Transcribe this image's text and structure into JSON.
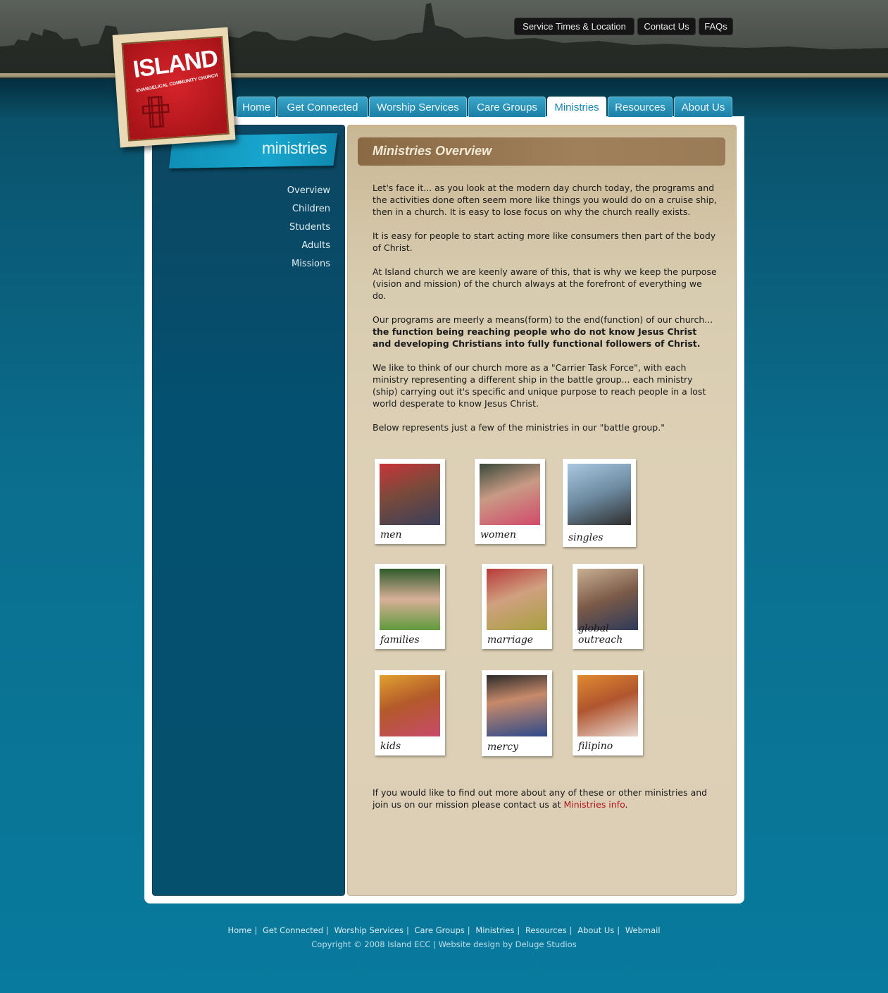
{
  "top_links": {
    "service_times": "Service Times & Location",
    "contact": "Contact Us",
    "faqs": "FAQs"
  },
  "logo": {
    "word": "ISLAND",
    "sub": "EVANGELICAL COMMUNITY CHURCH"
  },
  "nav": {
    "home": "Home",
    "get_connected": "Get Connected",
    "worship": "Worship Services",
    "care_groups": "Care Groups",
    "ministries": "Ministries",
    "resources": "Resources",
    "about": "About Us"
  },
  "sidebar": {
    "title": "ministries",
    "items": [
      "Overview",
      "Children",
      "Students",
      "Adults",
      "Missions"
    ]
  },
  "main": {
    "title": "Ministries Overview",
    "p1": "Let's face it... as you look at the modern day church today, the programs and the activities done often seem more like things you would do on a cruise ship, then in a church. It is easy to lose focus on why the church really exists.",
    "p2": "It is easy for people to start acting more like consumers then part of the body of Christ.",
    "p3": "At Island church we are keenly aware of this, that is why we keep the purpose (vision and mission) of the church always at the forefront of everything we do.",
    "p4_plain": "Our programs are meerly a means(form) to the end(function) of our church...",
    "p4_bold": "the function being reaching people who do not know Jesus Christ and developing Christians into fully functional followers of Christ.",
    "p5": "We like to think of our church more as a \"Carrier Task Force\", with each ministry representing a different ship in the battle group... each ministry (ship) carrying out it's specific and unique purpose to reach people in a lost world desperate to know Jesus Christ.",
    "p6": "Below represents just a few of the ministries in our \"battle group.\"",
    "closing_plain": "If you would like to find out more about any of these or other ministries and join us on our mission please contact us at ",
    "closing_link": "Ministries info",
    "closing_end": "."
  },
  "ministries": [
    {
      "caption": "men",
      "color": "#7a4a3a"
    },
    {
      "caption": "women",
      "color": "#8b6a5a"
    },
    {
      "caption": "singles",
      "color": "#6d8aa0"
    },
    {
      "caption": "families",
      "color": "#5f7d3c"
    },
    {
      "caption": "marriage",
      "color": "#a89a3f"
    },
    {
      "caption": "global outreach",
      "color": "#7a6a58"
    },
    {
      "caption": "kids",
      "color": "#b35a2a"
    },
    {
      "caption": "mercy",
      "color": "#5a6f8f"
    },
    {
      "caption": "filipino",
      "color": "#b0552e"
    }
  ],
  "footer": {
    "links": [
      "Home",
      "Get Connected",
      "Worship Services",
      "Care Groups",
      "Ministries",
      "Resources",
      "About Us",
      "Webmail"
    ],
    "copyright": "Copyright © 2008 Island ECC | Website design by Deluge Studios"
  }
}
